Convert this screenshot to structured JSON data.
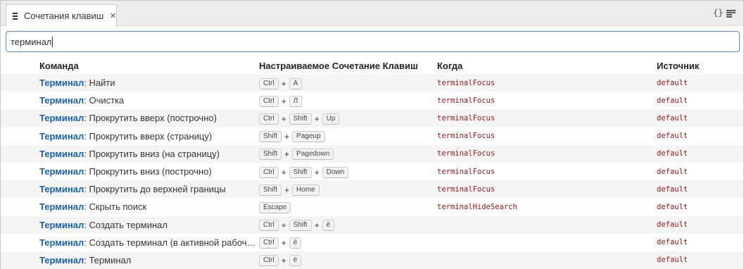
{
  "tab": {
    "title": "Сочетания клавиш",
    "close_glyph": "×",
    "menu_icon": "menu-icon"
  },
  "toolbar": {
    "json_glyph": "{}",
    "json_icon": "open-json-icon",
    "list_icon": "keyboard-layout-icon"
  },
  "search": {
    "value": "терминал"
  },
  "columns": {
    "command": "Команда",
    "keybinding": "Настраиваемое Сочетание Клавиш",
    "when": "Когда",
    "source": "Источник"
  },
  "rows": [
    {
      "category": "Терминал",
      "label": ": Найти",
      "keys": [
        "Ctrl",
        "A"
      ],
      "when": "terminalFocus",
      "source": "default"
    },
    {
      "category": "Терминал",
      "label": ": Очистка",
      "keys": [
        "Ctrl",
        "Л"
      ],
      "when": "terminalFocus",
      "source": "default"
    },
    {
      "category": "Терминал",
      "label": ": Прокрутить вверх (построчно)",
      "keys": [
        "Ctrl",
        "Shift",
        "Up"
      ],
      "when": "terminalFocus",
      "source": "default"
    },
    {
      "category": "Терминал",
      "label": ": Прокрутить вверх (страницу)",
      "keys": [
        "Shift",
        "Pageup"
      ],
      "when": "terminalFocus",
      "source": "default"
    },
    {
      "category": "Терминал",
      "label": ": Прокрутить вниз (на страницу)",
      "keys": [
        "Shift",
        "Pagedown"
      ],
      "when": "terminalFocus",
      "source": "default"
    },
    {
      "category": "Терминал",
      "label": ": Прокрутить вниз (построчно)",
      "keys": [
        "Ctrl",
        "Shift",
        "Down"
      ],
      "when": "terminalFocus",
      "source": "default"
    },
    {
      "category": "Терминал",
      "label": ": Прокрутить до верхней границы",
      "keys": [
        "Shift",
        "Home"
      ],
      "when": "terminalFocus",
      "source": "default"
    },
    {
      "category": "Терминал",
      "label": ": Скрыть поиск",
      "keys": [
        "Escape"
      ],
      "when": "terminalHideSearch",
      "source": "default"
    },
    {
      "category": "Терминал",
      "label": ": Создать терминал",
      "keys": [
        "Ctrl",
        "Shift",
        "ё"
      ],
      "when": "",
      "source": "default"
    },
    {
      "category": "Терминал",
      "label": ": Создать терминал (в активной рабочей ...",
      "keys": [
        "Ctrl",
        "ё"
      ],
      "when": "",
      "source": "default"
    },
    {
      "category": "Терминал",
      "label": ": Терминал",
      "keys": [
        "Ctrl",
        "ё"
      ],
      "when": "",
      "source": "default"
    }
  ],
  "colors": {
    "accent": "#1561b5",
    "when_text": "#a31515",
    "focus_border": "#4d8fd6"
  }
}
